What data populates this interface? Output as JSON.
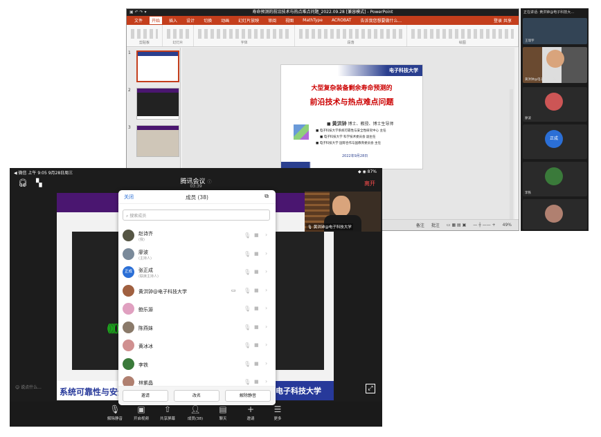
{
  "ppt": {
    "window_title": "寿命预测的前沿技术与热点难点问题_2022.09.28 [兼容模式] - PowerPoint",
    "tabs": [
      "文件",
      "开始",
      "插入",
      "设计",
      "切换",
      "动画",
      "幻灯片放映",
      "审阅",
      "视图",
      "MathType",
      "ACROBAT",
      "告诉我您想要做什么..."
    ],
    "login": "登录",
    "share": "共享",
    "groups": [
      "剪贴板",
      "幻灯片",
      "字体",
      "段落",
      "绘图"
    ],
    "thumb_numbers": [
      "1",
      "2",
      "3"
    ],
    "slide": {
      "logo": "电子科技大学",
      "title1": "大型复杂装备剩余寿命预测的",
      "title2": "前沿技术与热点难点问题",
      "name": "黄洪钟",
      "name_tail": "博士、教授、博士生导师",
      "lines": [
        "电子科技大学系统可靠性与安全性研究中心 主任",
        "电子科技大学 科学技术委员会 副主任",
        "电子科技大学 国际合作与国教育委员会 主任"
      ],
      "date": "2022年9月28日"
    },
    "status": [
      "备注",
      "批注"
    ],
    "zoom": "49%"
  },
  "gallery": {
    "header": "正在讲话: 黄洪钟@电子科技大…",
    "tiles": [
      {
        "name": "王瑞宇"
      },
      {
        "name": "黄洪钟@电子科技大学"
      },
      {
        "name": "廖波"
      },
      {
        "name": "正成",
        "avatar_text": "正成"
      },
      {
        "name": "张正成"
      },
      {
        "name": "李铁"
      },
      {
        "name": "林紫晶"
      }
    ]
  },
  "phone": {
    "status_left": "◀ 微信  上午 9:05  9月28日周三",
    "status_right": "87%",
    "title": "腾讯会议",
    "time": "03:39",
    "end": "离开",
    "selfview_name": "黄洪钟@电子科技大学",
    "chat_placeholder": "说点什么...",
    "share_logo_left": "系统可靠性与安全",
    "share_logo_right": "电子科技大学",
    "toolbar": [
      "解除静音",
      "开启视频",
      "共享屏幕",
      "成员(38)",
      "聊天",
      "邀请",
      "更多"
    ]
  },
  "members": {
    "close": "关闭",
    "title": "成员 (38)",
    "search_placeholder": "搜索成员",
    "rows": [
      {
        "name": "赵诗齐",
        "sub": "(我)",
        "color": "#554"
      },
      {
        "name": "廖波",
        "sub": "(主持人)",
        "color": "#7a8a9a"
      },
      {
        "name": "张正成",
        "sub": "(联席主持人)",
        "color": "#2b6fd6",
        "avatar_text": "正成"
      },
      {
        "name": "黄洪钟@电子科技大学",
        "sub": "",
        "color": "#a06040"
      },
      {
        "name": "鲍乐源",
        "sub": "",
        "color": "#e0a0c0"
      },
      {
        "name": "陈燕妹",
        "sub": "",
        "color": "#8a7a6a"
      },
      {
        "name": "黄冰冰",
        "sub": "",
        "color": "#d09090"
      },
      {
        "name": "李铁",
        "sub": "",
        "color": "#3a7a3a"
      },
      {
        "name": "林紫晶",
        "sub": "",
        "color": "#b08070"
      }
    ],
    "buttons": [
      "邀请",
      "改名",
      "解除静音"
    ]
  }
}
